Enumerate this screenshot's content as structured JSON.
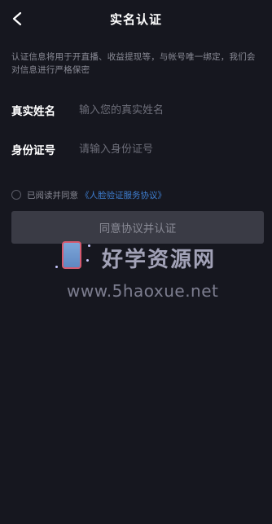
{
  "header": {
    "title": "实名认证",
    "back_icon": "chevron-left-icon"
  },
  "notice": "认证信息将用于开直播、收益提现等，与帐号唯一绑定，我们会对信息进行严格保密",
  "form": {
    "name_label": "真实姓名",
    "name_placeholder": "输入您的真实姓名",
    "name_value": "",
    "id_label": "身份证号",
    "id_placeholder": "请输入身份证号",
    "id_value": ""
  },
  "agreement": {
    "text": "已阅读并同意",
    "link": "《人脸验证服务协议》",
    "checked": false
  },
  "submit": {
    "label": "同意协议并认证"
  },
  "watermark": {
    "title": "好学资源网",
    "url": "www.5haoxue.net"
  },
  "colors": {
    "background": "#16171f",
    "link": "#3f7fd2",
    "button_disabled": "#3a3b45"
  }
}
